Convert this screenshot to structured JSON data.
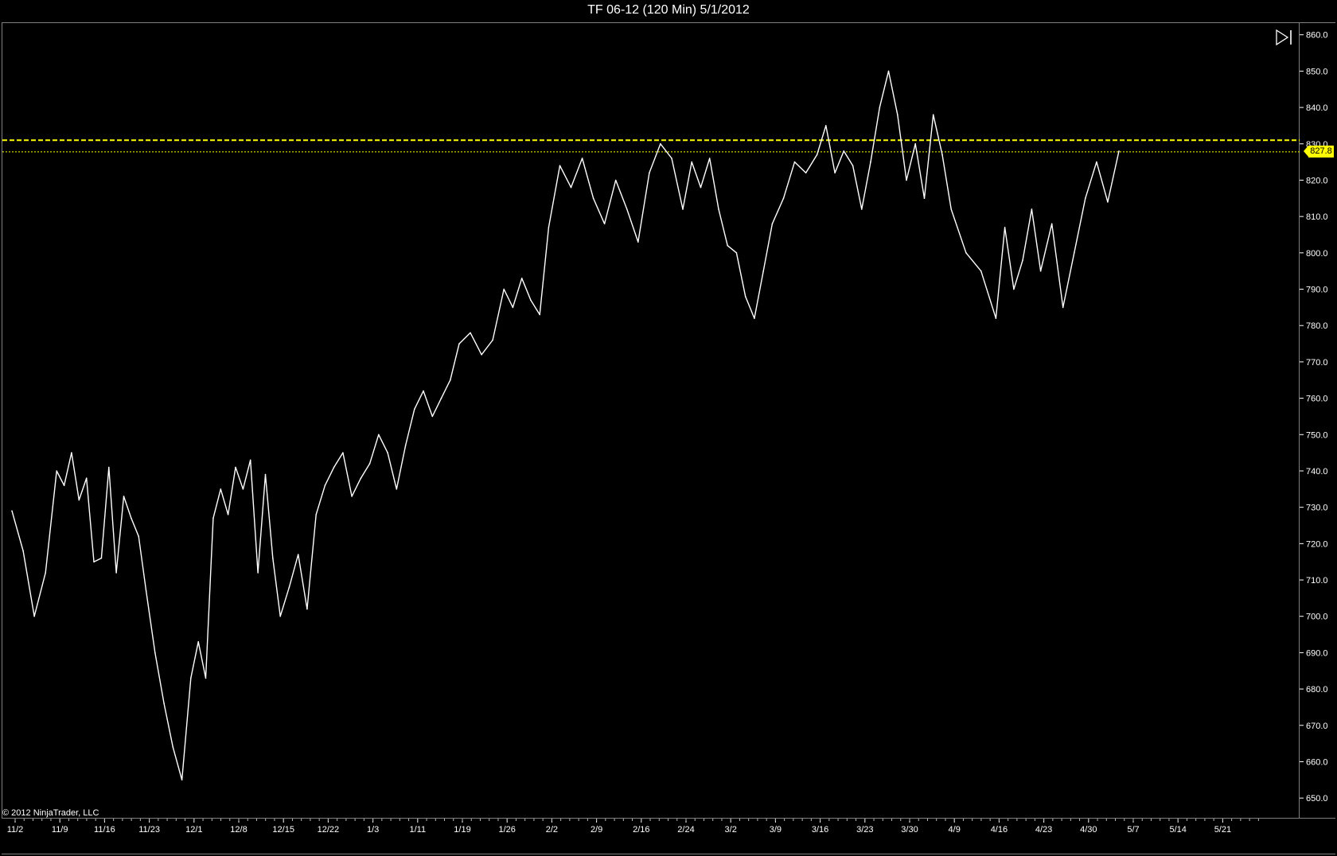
{
  "window": {
    "title": "TF 06-12 (120 Min)  5/1/2012",
    "copyright": "© 2012 NinjaTrader, LLC"
  },
  "colors": {
    "background": "#000000",
    "price_line": "#ffffff",
    "level_line": "#ffff00",
    "price_tag": "#ffff00"
  },
  "icons": {
    "scroll_to_end": "play-to-end-icon"
  },
  "price_marker": {
    "value": "827.8"
  },
  "chart_data": {
    "type": "line",
    "title": "TF 06-12 (120 Min)  5/1/2012",
    "x_tick_labels": [
      "11/2",
      "11/9",
      "11/16",
      "11/23",
      "12/1",
      "12/8",
      "12/15",
      "12/22",
      "1/3",
      "1/11",
      "1/19",
      "1/26",
      "2/2",
      "2/9",
      "2/16",
      "2/24",
      "3/2",
      "3/9",
      "3/16",
      "3/23",
      "3/30",
      "4/9",
      "4/16",
      "4/23",
      "4/30",
      "5/7",
      "5/14",
      "5/21"
    ],
    "y_tick_labels": [
      "860.0",
      "850.0",
      "840.0",
      "830.0",
      "820.0",
      "810.0",
      "800.0",
      "790.0",
      "780.0",
      "770.0",
      "760.0",
      "750.0",
      "740.0",
      "730.0",
      "720.0",
      "710.0",
      "700.0",
      "690.0",
      "680.0",
      "670.0",
      "660.0",
      "650.0"
    ],
    "ylim": [
      645,
      863
    ],
    "grid": false,
    "horizontal_levels": [
      {
        "value": 831.0,
        "style": "dashed"
      },
      {
        "value": 827.8,
        "style": "dotted"
      }
    ],
    "series": [
      {
        "points": [
          [
            "11/2",
            729
          ],
          [
            "11/2",
            718
          ],
          [
            "11/2",
            700
          ],
          [
            "11/2",
            712
          ],
          [
            "11/9",
            740
          ],
          [
            "11/9",
            736
          ],
          [
            "11/9",
            745
          ],
          [
            "11/9",
            732
          ],
          [
            "11/9",
            738
          ],
          [
            "11/9",
            715
          ],
          [
            "11/16",
            716
          ],
          [
            "11/16",
            741
          ],
          [
            "11/16",
            712
          ],
          [
            "11/16",
            733
          ],
          [
            "11/16",
            727
          ],
          [
            "11/16",
            722
          ],
          [
            "11/23",
            707
          ],
          [
            "11/23",
            690
          ],
          [
            "11/23",
            676
          ],
          [
            "11/23",
            664
          ],
          [
            "11/23",
            655
          ],
          [
            "12/1",
            683
          ],
          [
            "12/1",
            693
          ],
          [
            "12/1",
            683
          ],
          [
            "12/1",
            727
          ],
          [
            "12/1",
            735
          ],
          [
            "12/1",
            728
          ],
          [
            "12/8",
            741
          ],
          [
            "12/8",
            735
          ],
          [
            "12/8",
            743
          ],
          [
            "12/8",
            712
          ],
          [
            "12/8",
            739
          ],
          [
            "12/8",
            716
          ],
          [
            "12/15",
            700
          ],
          [
            "12/15",
            708
          ],
          [
            "12/15",
            717
          ],
          [
            "12/15",
            702
          ],
          [
            "12/15",
            728
          ],
          [
            "12/22",
            736
          ],
          [
            "12/22",
            741
          ],
          [
            "12/22",
            745
          ],
          [
            "12/22",
            733
          ],
          [
            "12/22",
            738
          ],
          [
            "1/3",
            742
          ],
          [
            "1/3",
            750
          ],
          [
            "1/3",
            745
          ],
          [
            "1/3",
            735
          ],
          [
            "1/3",
            747
          ],
          [
            "1/11",
            757
          ],
          [
            "1/11",
            762
          ],
          [
            "1/11",
            755
          ],
          [
            "1/11",
            760
          ],
          [
            "1/11",
            765
          ],
          [
            "1/19",
            775
          ],
          [
            "1/19",
            778
          ],
          [
            "1/19",
            772
          ],
          [
            "1/19",
            776
          ],
          [
            "1/26",
            790
          ],
          [
            "1/26",
            785
          ],
          [
            "1/26",
            793
          ],
          [
            "1/26",
            787
          ],
          [
            "1/26",
            783
          ],
          [
            "2/2",
            807
          ],
          [
            "2/2",
            824
          ],
          [
            "2/2",
            818
          ],
          [
            "2/2",
            826
          ],
          [
            "2/9",
            815
          ],
          [
            "2/9",
            808
          ],
          [
            "2/9",
            820
          ],
          [
            "2/9",
            812
          ],
          [
            "2/16",
            803
          ],
          [
            "2/16",
            822
          ],
          [
            "2/16",
            830
          ],
          [
            "2/16",
            826
          ],
          [
            "2/24",
            812
          ],
          [
            "2/24",
            825
          ],
          [
            "2/24",
            818
          ],
          [
            "2/24",
            826
          ],
          [
            "2/24",
            812
          ],
          [
            "3/2",
            802
          ],
          [
            "3/2",
            800
          ],
          [
            "3/2",
            788
          ],
          [
            "3/2",
            782
          ],
          [
            "3/2",
            795
          ],
          [
            "3/9",
            808
          ],
          [
            "3/9",
            815
          ],
          [
            "3/9",
            825
          ],
          [
            "3/9",
            822
          ],
          [
            "3/16",
            827
          ],
          [
            "3/16",
            835
          ],
          [
            "3/16",
            822
          ],
          [
            "3/16",
            828
          ],
          [
            "3/16",
            824
          ],
          [
            "3/23",
            812
          ],
          [
            "3/23",
            825
          ],
          [
            "3/23",
            840
          ],
          [
            "3/23",
            850
          ],
          [
            "3/23",
            838
          ],
          [
            "3/30",
            820
          ],
          [
            "3/30",
            830
          ],
          [
            "3/30",
            815
          ],
          [
            "3/30",
            838
          ],
          [
            "3/30",
            827
          ],
          [
            "4/9",
            812
          ],
          [
            "4/9",
            800
          ],
          [
            "4/9",
            795
          ],
          [
            "4/16",
            782
          ],
          [
            "4/16",
            807
          ],
          [
            "4/16",
            790
          ],
          [
            "4/16",
            798
          ],
          [
            "4/16",
            812
          ],
          [
            "4/23",
            795
          ],
          [
            "4/23",
            808
          ],
          [
            "4/23",
            785
          ],
          [
            "4/23",
            800
          ],
          [
            "4/30",
            815
          ],
          [
            "4/30",
            825
          ],
          [
            "4/30",
            814
          ],
          [
            "4/30",
            828
          ]
        ]
      }
    ]
  }
}
